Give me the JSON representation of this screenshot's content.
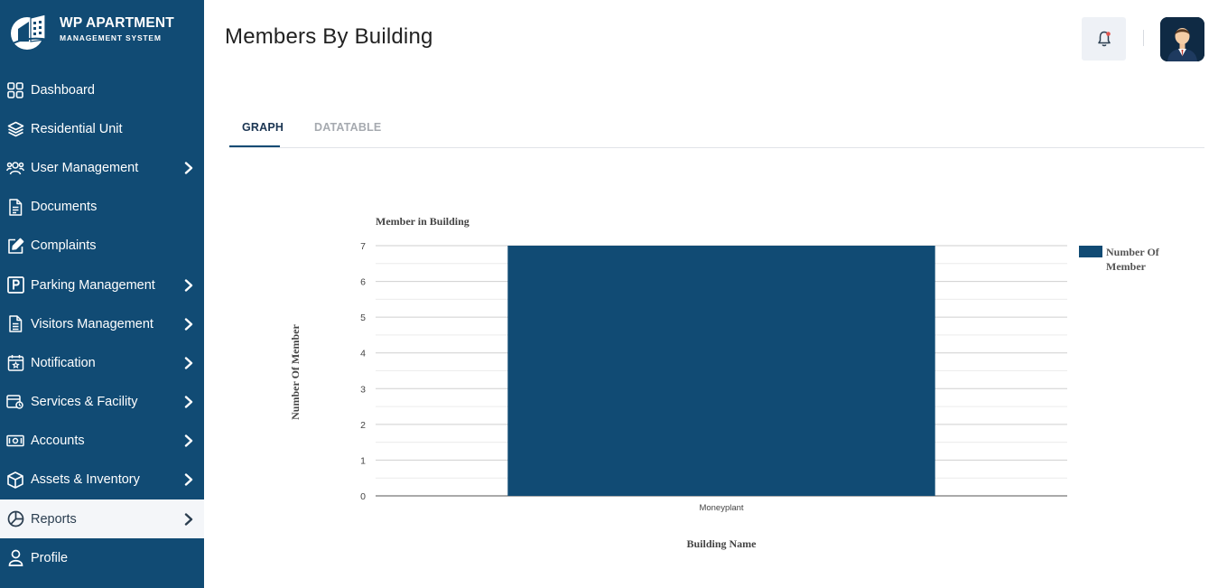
{
  "app": {
    "brand_line1": "WP APARTMENT",
    "brand_line2": "MANAGEMENT SYSTEM"
  },
  "sidebar": {
    "items": [
      {
        "label": "Dashboard",
        "icon": "dashboard-grid-icon",
        "has_submenu": false
      },
      {
        "label": "Residential Unit",
        "icon": "layers-icon",
        "has_submenu": false
      },
      {
        "label": "User Management",
        "icon": "users-icon",
        "has_submenu": true
      },
      {
        "label": "Documents",
        "icon": "document-icon",
        "has_submenu": false
      },
      {
        "label": "Complaints",
        "icon": "edit-icon",
        "has_submenu": false
      },
      {
        "label": "Parking Management",
        "icon": "parking-icon",
        "has_submenu": true
      },
      {
        "label": "Visitors Management",
        "icon": "visitor-doc-icon",
        "has_submenu": true
      },
      {
        "label": "Notification",
        "icon": "calendar-star-icon",
        "has_submenu": true
      },
      {
        "label": "Services & Facility",
        "icon": "services-icon",
        "has_submenu": true
      },
      {
        "label": "Accounts",
        "icon": "money-icon",
        "has_submenu": true
      },
      {
        "label": "Assets & Inventory",
        "icon": "box-icon",
        "has_submenu": true
      },
      {
        "label": "Reports",
        "icon": "pie-chart-icon",
        "has_submenu": true,
        "active": true
      },
      {
        "label": "Profile",
        "icon": "user-icon",
        "has_submenu": false
      }
    ]
  },
  "header": {
    "title": "Members By Building"
  },
  "tabs": {
    "graph": "GRAPH",
    "datatable": "DATATABLE",
    "active": "graph"
  },
  "colors": {
    "sidebar_bg": "#114b74",
    "bar": "#114b74",
    "active_item_bg": "#f4f6f9"
  },
  "chart_data": {
    "type": "bar",
    "title": "Member in Building",
    "xlabel": "Building Name",
    "ylabel": "Number Of Member",
    "categories": [
      "Moneyplant"
    ],
    "series": [
      {
        "name": "Number Of Member",
        "values": [
          7
        ]
      }
    ],
    "ylim": [
      0,
      7
    ],
    "yticks": [
      0,
      1,
      2,
      3,
      4,
      5,
      6,
      7
    ],
    "legend_position": "right",
    "grid": true
  }
}
